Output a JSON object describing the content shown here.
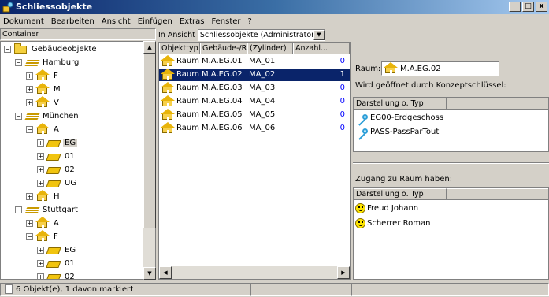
{
  "window": {
    "title": "Schliessobjekte",
    "controls": [
      "_",
      "□",
      "x"
    ]
  },
  "menu": [
    {
      "label": "Dokument"
    },
    {
      "label": "Bearbeiten"
    },
    {
      "label": "Ansicht"
    },
    {
      "label": "Einfügen"
    },
    {
      "label": "Extras"
    },
    {
      "label": "Fenster"
    },
    {
      "label": "?"
    }
  ],
  "left_panel": {
    "header": "Container",
    "tree": [
      {
        "label": "Gebäudeobjekte",
        "icon": "folder-icon",
        "toggle": "−"
      },
      {
        "label": "Hamburg",
        "icon": "city-icon",
        "toggle": "−"
      },
      {
        "label": "F",
        "icon": "house-icon",
        "toggle": "+"
      },
      {
        "label": "M",
        "icon": "house-icon",
        "toggle": "+"
      },
      {
        "label": "V",
        "icon": "house-icon",
        "toggle": "+"
      },
      {
        "label": "München",
        "icon": "city-icon",
        "toggle": "−"
      },
      {
        "label": "A",
        "icon": "house-icon",
        "toggle": "−"
      },
      {
        "label": "EG",
        "icon": "floor-icon",
        "toggle": "+",
        "selected": true
      },
      {
        "label": "01",
        "icon": "floor-icon",
        "toggle": "+"
      },
      {
        "label": "02",
        "icon": "floor-icon",
        "toggle": "+"
      },
      {
        "label": "UG",
        "icon": "floor-icon",
        "toggle": "+"
      },
      {
        "label": "H",
        "icon": "house-icon",
        "toggle": "+"
      },
      {
        "label": "Stuttgart",
        "icon": "city-icon",
        "toggle": "−"
      },
      {
        "label": "A",
        "icon": "house-icon",
        "toggle": "+"
      },
      {
        "label": "F",
        "icon": "house-icon",
        "toggle": "−"
      },
      {
        "label": "EG",
        "icon": "floor-icon",
        "toggle": "+"
      },
      {
        "label": "01",
        "icon": "floor-icon",
        "toggle": "+"
      },
      {
        "label": "02",
        "icon": "floor-icon",
        "toggle": "+"
      }
    ]
  },
  "middle_panel": {
    "in_label": "In",
    "view_label": "Ansicht",
    "view_value": "Schliessobjekte (Administrator)",
    "columns": [
      "Objekttyp",
      "Gebäude-/Ra...",
      "(Zylinder)",
      "Anzahl..."
    ],
    "rows": [
      {
        "type": "Raum",
        "name": "M.A.EG.01",
        "cyl": "MA_01",
        "count": "0"
      },
      {
        "type": "Raum",
        "name": "M.A.EG.02",
        "cyl": "MA_02",
        "count": "1",
        "selected": true
      },
      {
        "type": "Raum",
        "name": "M.A.EG.03",
        "cyl": "MA_03",
        "count": "0"
      },
      {
        "type": "Raum",
        "name": "M.A.EG.04",
        "cyl": "MA_04",
        "count": "0"
      },
      {
        "type": "Raum",
        "name": "M.A.EG.05",
        "cyl": "MA_05",
        "count": "0"
      },
      {
        "type": "Raum",
        "name": "M.A.EG.06",
        "cyl": "MA_06",
        "count": "0"
      }
    ]
  },
  "right_panel": {
    "raum_label": "Raum:",
    "raum_value": "M.A.EG.02",
    "opened_by_label": "Wird geöffnet durch Konzeptschlüssel:",
    "keys_header": "Darstellung o. Typ",
    "keys": [
      {
        "label": "EG00-Erdgeschoss"
      },
      {
        "label": "PASS-PassParTout"
      }
    ],
    "access_label": "Zugang zu Raum haben:",
    "persons_header": "Darstellung o. Typ",
    "persons": [
      {
        "label": "Freud Johann"
      },
      {
        "label": "Scherrer Roman"
      }
    ]
  },
  "statusbar": {
    "text": "6 Objekt(e), 1 davon markiert"
  },
  "colors": {
    "selection": "#0a246a",
    "count_blue": "#0000ff",
    "window_bg": "#d4d0c8"
  }
}
